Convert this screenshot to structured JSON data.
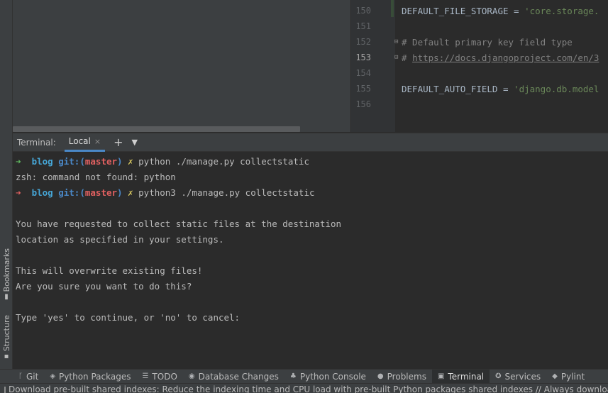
{
  "editor": {
    "lines": [
      {
        "num": "150",
        "parts": [
          {
            "cls": "kw-const",
            "text": "DEFAULT_FILE_STORAGE = "
          },
          {
            "cls": "str",
            "text": "'core.storage."
          }
        ]
      },
      {
        "num": "151",
        "parts": []
      },
      {
        "num": "152",
        "parts": [
          {
            "cls": "cmt",
            "text": "# Default primary key field type"
          }
        ]
      },
      {
        "num": "153",
        "parts": [
          {
            "cls": "cmt",
            "text": "# "
          },
          {
            "cls": "url",
            "text": "https://docs.djangoproject.com/en/3"
          }
        ]
      },
      {
        "num": "154",
        "parts": []
      },
      {
        "num": "155",
        "parts": [
          {
            "cls": "kw-const",
            "text": "DEFAULT_AUTO_FIELD = "
          },
          {
            "cls": "str",
            "text": "'django.db.model"
          }
        ]
      },
      {
        "num": "156",
        "parts": []
      }
    ]
  },
  "terminal": {
    "title": "Terminal:",
    "tab_label": "Local",
    "close_glyph": "×",
    "add_glyph": "+",
    "more_glyph": "▼",
    "prompt": {
      "arrow": "➜",
      "dir": "blog",
      "git_prefix": "git:(",
      "branch": "master",
      "git_suffix": ")",
      "dirty": "✗"
    },
    "cmd1": "python ./manage.py collectstatic",
    "err1": "zsh: command not found: python",
    "cmd2": "python3 ./manage.py collectstatic",
    "out1": "You have requested to collect static files at the destination",
    "out2": "location as specified in your settings.",
    "out3": "This will overwrite existing files!",
    "out4": "Are you sure you want to do this?",
    "out5": "Type 'yes' to continue, or 'no' to cancel:"
  },
  "side_tabs": {
    "bookmarks": "Bookmarks",
    "structure": "Structure"
  },
  "toolbar": {
    "git": "Git",
    "python_packages": "Python Packages",
    "todo": "TODO",
    "database_changes": "Database Changes",
    "python_console": "Python Console",
    "problems": "Problems",
    "terminal": "Terminal",
    "services": "Services",
    "pylint": "Pylint"
  },
  "status": {
    "message": "Download pre-built shared indexes: Reduce the indexing time and CPU load with pre-built Python packages shared indexes // Always download"
  }
}
